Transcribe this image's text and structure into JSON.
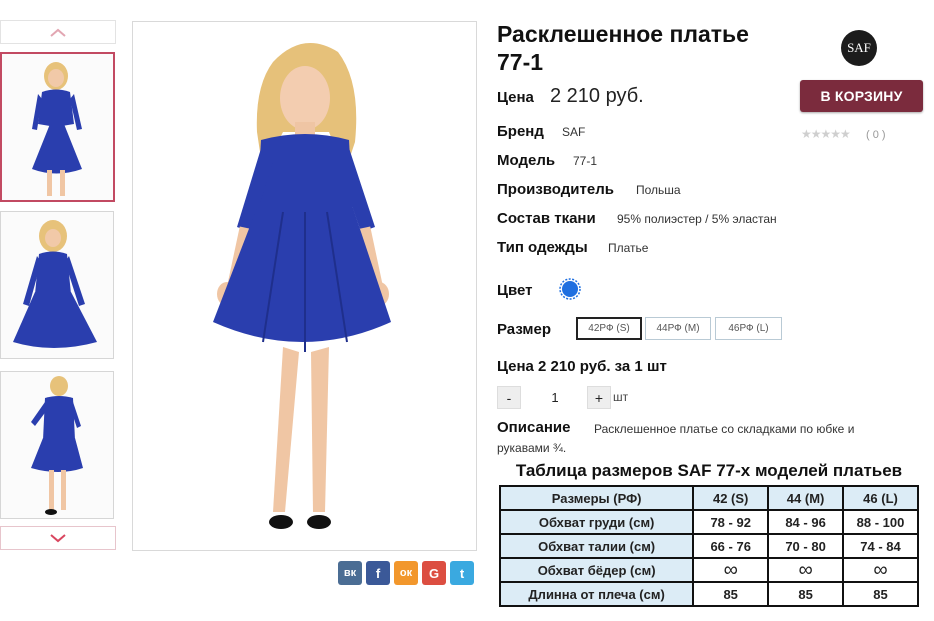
{
  "product": {
    "title": "Расклешенное платье 77-1",
    "price_label": "Цена",
    "price_value": "2 210 руб.",
    "cart_button": "В КОРЗИНУ",
    "brand_logo_text": "SAF",
    "stars": "★★★★★",
    "rating_count": "( 0 )",
    "specs": [
      {
        "label": "Бренд",
        "value": "SAF"
      },
      {
        "label": "Модель",
        "value": "77-1"
      },
      {
        "label": "Производитель",
        "value": "Польша"
      },
      {
        "label": "Состав ткани",
        "value": "95% полиэстер / 5% эластан"
      },
      {
        "label": "Тип одежды",
        "value": "Платье"
      }
    ],
    "color_label": "Цвет",
    "color_value": "#1f6fe0",
    "size_label": "Размер",
    "sizes": [
      "42РФ (S)",
      "44РФ (M)",
      "46РФ (L)"
    ],
    "unit_price_text": "Цена 2 210 руб. за 1 шт",
    "qty_minus": "-",
    "qty_value": "1",
    "qty_plus": "+",
    "qty_unit": "шт",
    "description_label": "Описание",
    "description_line1": "Расклешенное платье со складками по юбке и",
    "description_line2": "рукавами ¾."
  },
  "size_table": {
    "title": "Таблица размеров SAF 77-х моделей платьев",
    "header": [
      "Размеры (РФ)",
      "42 (S)",
      "44 (M)",
      "46 (L)"
    ],
    "rows": [
      [
        "Обхват груди (см)",
        "78 - 92",
        "84 - 96",
        "88 - 100"
      ],
      [
        "Обхват талии (см)",
        "66 - 76",
        "70 - 80",
        "74 - 84"
      ],
      [
        "Обхват бёдер (см)",
        "∞",
        "∞",
        "∞"
      ],
      [
        "Длинна от плеча (см)",
        "85",
        "85",
        "85"
      ]
    ]
  },
  "share": {
    "vk": "вк",
    "facebook": "f",
    "odnoklassniki": "ок",
    "google": "G",
    "twitter": "t"
  },
  "colors": {
    "accent": "#7b2b3d",
    "dress": "#2a3eae",
    "table_highlight": "#dcecf6"
  }
}
